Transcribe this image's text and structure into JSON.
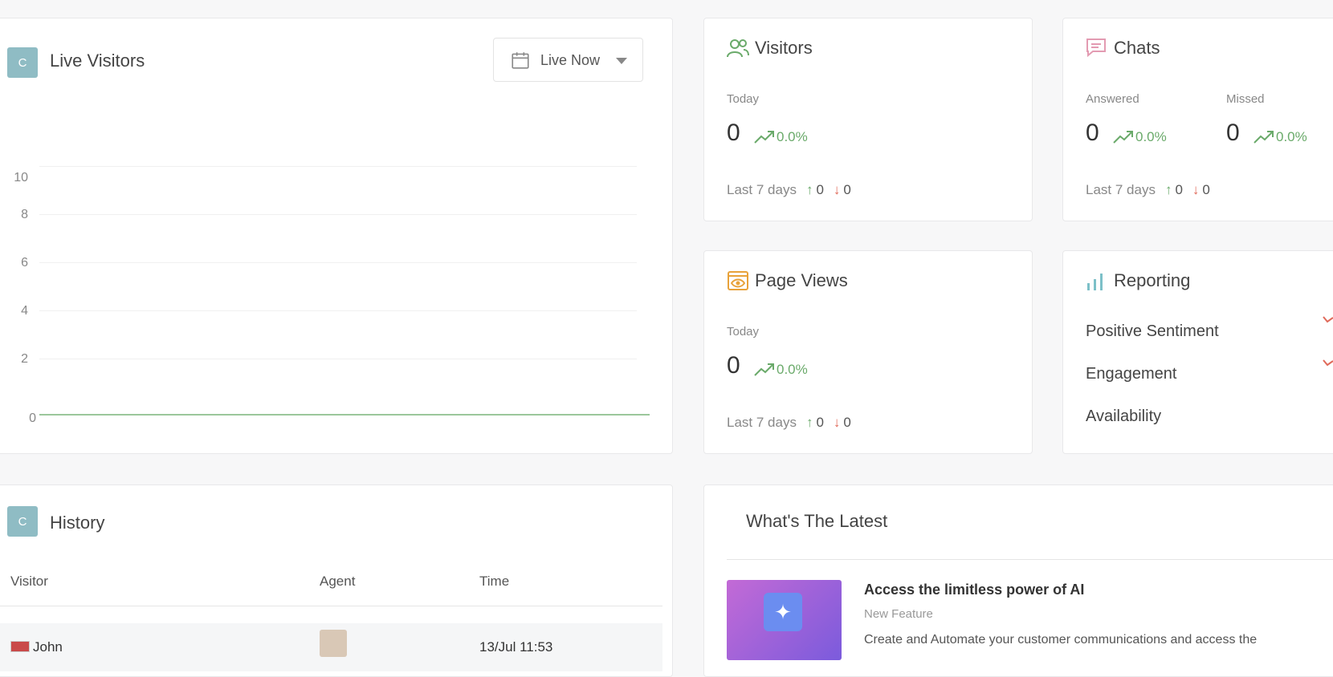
{
  "live_visitors": {
    "badge": "C",
    "title": "Live Visitors",
    "range_label": "Live Now",
    "y_ticks": [
      "10",
      "8",
      "6",
      "4",
      "2",
      "0"
    ]
  },
  "chart_data": {
    "type": "line",
    "title": "",
    "xlabel": "",
    "ylabel": "",
    "ylim": [
      0,
      10
    ],
    "y_ticks": [
      0,
      2,
      4,
      6,
      8,
      10
    ],
    "x": [
      0,
      1
    ],
    "series": [
      {
        "values": [
          0,
          0
        ]
      }
    ],
    "grid": true
  },
  "visitors": {
    "title": "Visitors",
    "label": "Today",
    "value": "0",
    "trend": "0.0%",
    "last7_label": "Last 7 days",
    "up": "0",
    "down": "0"
  },
  "chats": {
    "title": "Chats",
    "answered_label": "Answered",
    "answered_value": "0",
    "answered_trend": "0.0%",
    "missed_label": "Missed",
    "missed_value": "0",
    "missed_trend": "0.0%",
    "last7_label": "Last 7 days",
    "up": "0",
    "down": "0"
  },
  "page_views": {
    "title": "Page Views",
    "label": "Today",
    "value": "0",
    "trend": "0.0%",
    "last7_label": "Last 7 days",
    "up": "0",
    "down": "0"
  },
  "reporting": {
    "title": "Reporting",
    "rows": [
      "Positive Sentiment",
      "Engagement",
      "Availability"
    ]
  },
  "history": {
    "badge": "C",
    "title": "History",
    "columns": [
      "Visitor",
      "Agent",
      "Time"
    ],
    "rows": [
      {
        "visitor": "John",
        "time": "13/Jul 11:53"
      }
    ]
  },
  "latest": {
    "title": "What's The Latest",
    "item_title": "Access the limitless power of AI",
    "item_tag": "New Feature",
    "item_text": "Create and Automate your customer communications and access the"
  },
  "colors": {
    "badge": "#8fbcc4",
    "trend_green": "#6aaa6a",
    "down_red": "#e06a5a",
    "line": "#9bc79b"
  }
}
